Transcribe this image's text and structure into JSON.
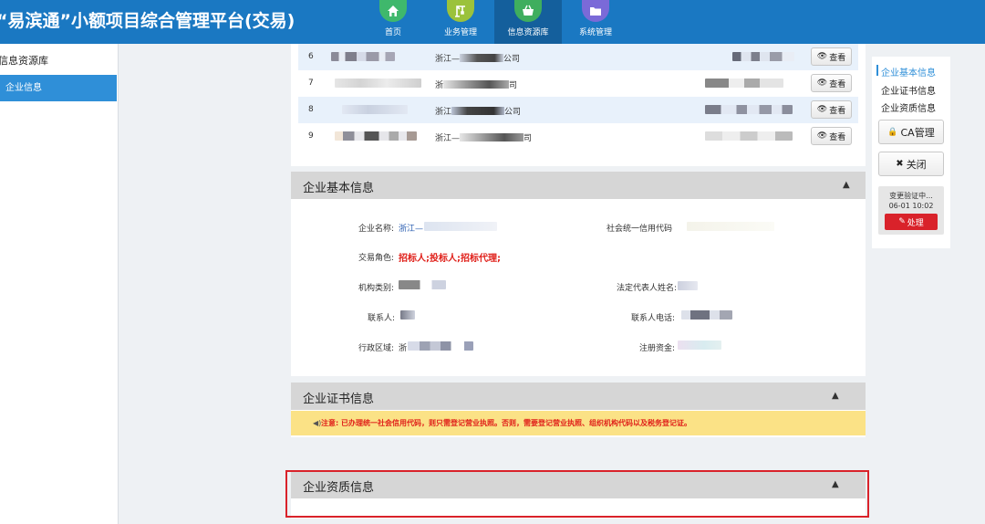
{
  "colors": {
    "header_bg": "#1a78c2",
    "accent": "#2f8fd8",
    "danger": "#d9222a",
    "notice_bg": "#fbe286",
    "role_text": "#e0201a"
  },
  "header": {
    "title": "“易滨通”小额项目综合管理平台(交易)",
    "nav": [
      {
        "label": "首页",
        "icon": "home-icon",
        "color": "#3fb86c"
      },
      {
        "label": "业务管理",
        "icon": "crane-icon",
        "color": "#9bc23c"
      },
      {
        "label": "信息资源库",
        "icon": "basket-icon",
        "color": "#3fae5e",
        "active": true
      },
      {
        "label": "系统管理",
        "icon": "folder-icon",
        "color": "#7a6ad8"
      }
    ]
  },
  "sidebar": {
    "heading": "信息资源库",
    "items": [
      {
        "label": "企业信息"
      }
    ]
  },
  "table": {
    "rows": [
      {
        "num": "6",
        "company": "浙江—",
        "company_suffix": "公司"
      },
      {
        "num": "7",
        "company": "浙",
        "company_suffix": "司"
      },
      {
        "num": "8",
        "company": "浙江",
        "company_suffix": "公司"
      },
      {
        "num": "9",
        "company": "浙江—",
        "company_suffix": "司"
      }
    ],
    "view_label": "查看"
  },
  "basic_info": {
    "title": "企业基本信息",
    "company_name_label": "企业名称:",
    "company_name_value": "浙江—",
    "credit_code_label": "社会统一信用代码",
    "role_label": "交易角色:",
    "role_value": "招标人;投标人;招标代理;",
    "org_type_label": "机构类别:",
    "legal_rep_label": "法定代表人姓名:",
    "contact_label": "联系人:",
    "contact_value": "",
    "phone_label": "联系人电话:",
    "region_label": "行政区域:",
    "region_value": "浙",
    "capital_label": "注册资金:"
  },
  "cert_info": {
    "title": "企业证书信息",
    "notice": "注意: 已办理统一社会信用代码，则只需登记营业执照。否则，需要登记营业执照、组织机构代码以及税务登记证。"
  },
  "qual_info": {
    "title": "企业资质信息"
  },
  "side_panel": {
    "links": [
      "企业基本信息",
      "企业证书信息",
      "企业资质信息"
    ],
    "ca_button": "CA管理",
    "close_button": "关闭",
    "pending_label": "变更验证中...",
    "pending_time": "06-01 10:02",
    "handle_button": "处理"
  }
}
